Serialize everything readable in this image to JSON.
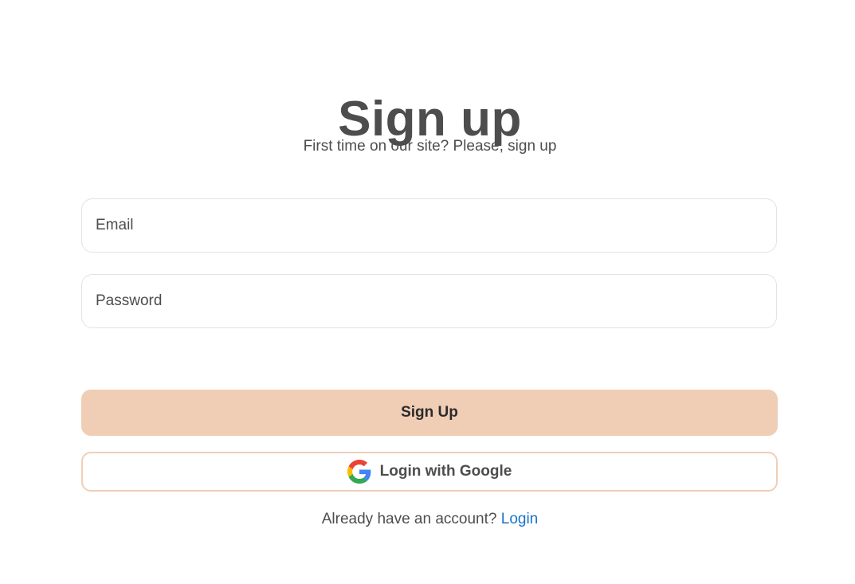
{
  "header": {
    "title": "Sign up",
    "subtitle": "First time on our site? Please, sign up"
  },
  "form": {
    "email": {
      "placeholder": "Email",
      "value": ""
    },
    "password": {
      "placeholder": "Password",
      "value": ""
    },
    "submit_label": "Sign Up",
    "google_label": "Login with Google",
    "google_icon": "google-g-icon"
  },
  "footer": {
    "prompt": "Already have an account?",
    "link_label": "Login"
  },
  "colors": {
    "primary_button": "#f0cdb5",
    "google_border": "#efcfb8",
    "link": "#1a73c8",
    "text": "#4d4d4d"
  }
}
